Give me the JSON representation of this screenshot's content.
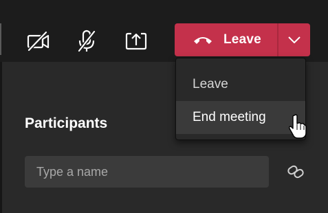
{
  "toolbar": {
    "camera_icon": "camera-off-icon",
    "mic_icon": "mic-off-icon",
    "share_icon": "share-screen-icon",
    "leave_label": "Leave",
    "leave_icon": "phone-hangup-icon",
    "dropdown_icon": "chevron-down-icon",
    "leave_color": "#c4314b"
  },
  "leave_menu": {
    "items": [
      {
        "label": "Leave"
      },
      {
        "label": "End meeting"
      }
    ]
  },
  "participants": {
    "title": "Participants",
    "search_placeholder": "Type a name",
    "link_icon": "link-icon"
  },
  "cursor": "hand-pointer-icon"
}
